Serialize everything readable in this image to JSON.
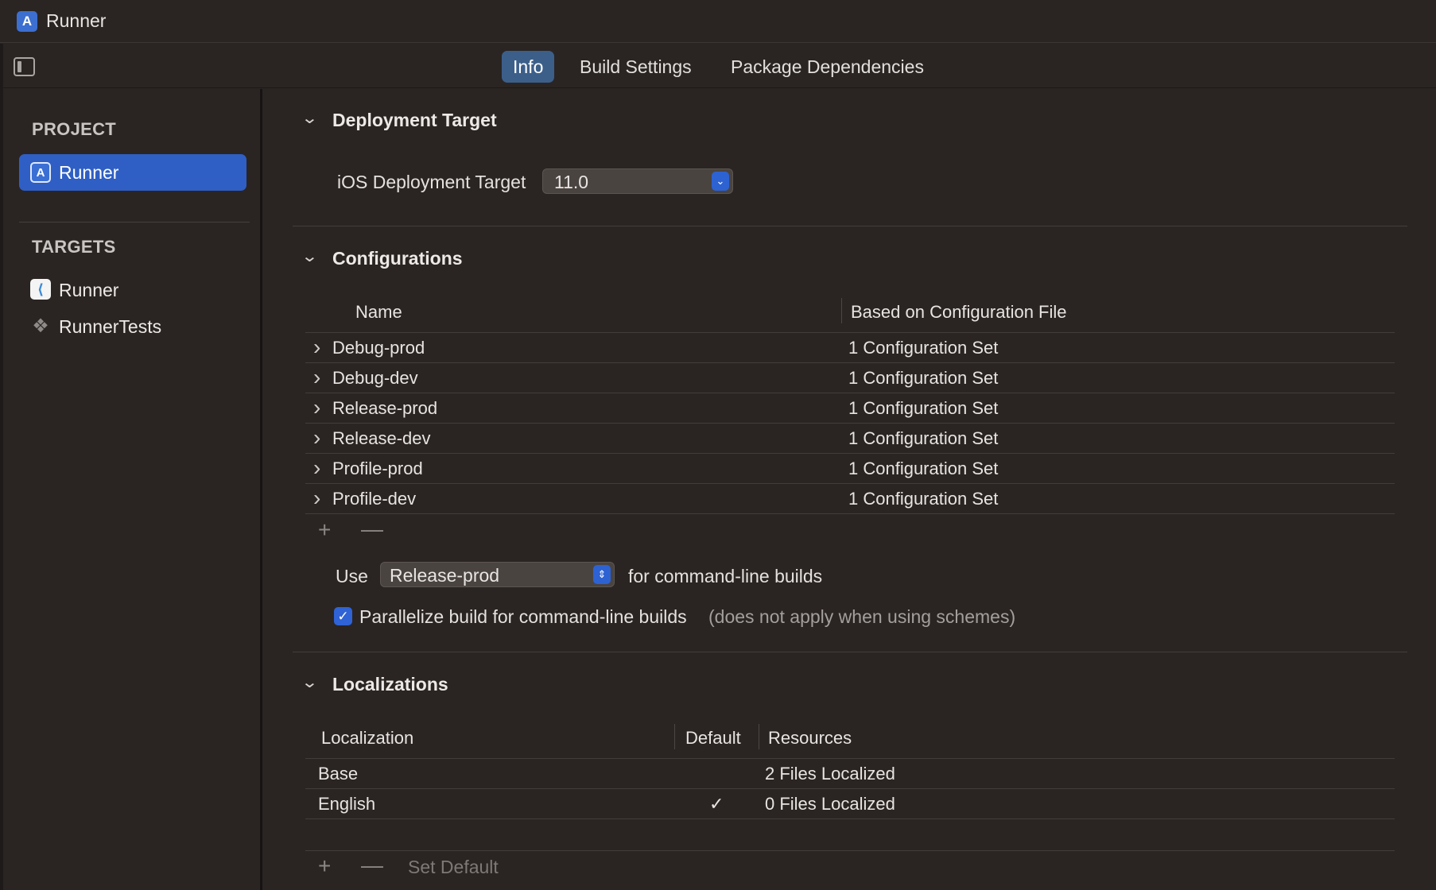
{
  "window": {
    "title": "Runner"
  },
  "tabs": [
    {
      "label": "Info",
      "selected": true
    },
    {
      "label": "Build Settings",
      "selected": false
    },
    {
      "label": "Package Dependencies",
      "selected": false
    }
  ],
  "sidebar": {
    "project_header": "PROJECT",
    "project_item": "Runner",
    "targets_header": "TARGETS",
    "targets": [
      {
        "label": "Runner",
        "icon": "flutter-icon"
      },
      {
        "label": "RunnerTests",
        "icon": "test-bundle-icon"
      }
    ]
  },
  "deployment": {
    "section_title": "Deployment Target",
    "label": "iOS Deployment Target",
    "value": "11.0"
  },
  "configurations": {
    "section_title": "Configurations",
    "col_name": "Name",
    "col_based": "Based on Configuration File",
    "rows": [
      {
        "name": "Debug-prod",
        "based": "1 Configuration Set"
      },
      {
        "name": "Debug-dev",
        "based": "1 Configuration Set"
      },
      {
        "name": "Release-prod",
        "based": "1 Configuration Set"
      },
      {
        "name": "Release-dev",
        "based": "1 Configuration Set"
      },
      {
        "name": "Profile-prod",
        "based": "1 Configuration Set"
      },
      {
        "name": "Profile-dev",
        "based": "1 Configuration Set"
      }
    ],
    "add_symbol": "+",
    "remove_symbol": "—",
    "use_label": "Use",
    "use_value": "Release-prod",
    "use_suffix": "for command-line builds",
    "parallelize_label": "Parallelize build for command-line builds",
    "parallelize_note": "(does not apply when using schemes)",
    "parallelize_checked": true
  },
  "localizations": {
    "section_title": "Localizations",
    "col_localization": "Localization",
    "col_default": "Default",
    "col_resources": "Resources",
    "rows": [
      {
        "name": "Base",
        "default": "",
        "resources": "2 Files Localized"
      },
      {
        "name": "English",
        "default": "✓",
        "resources": "0 Files Localized"
      }
    ],
    "add_symbol": "+",
    "remove_symbol": "—",
    "set_default": "Set Default"
  },
  "colors": {
    "background": "#2a2523",
    "accent": "#2f5fc4",
    "tab_selected": "#3c5f8a"
  }
}
